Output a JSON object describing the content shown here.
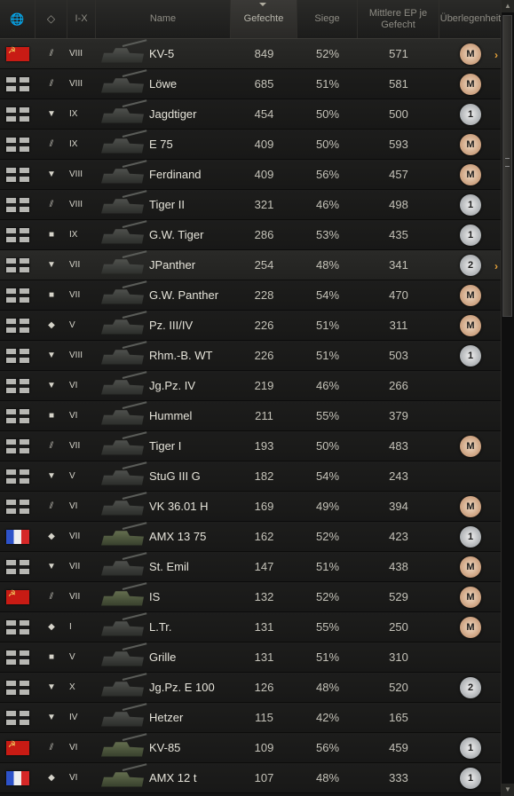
{
  "header": {
    "globe_icon": "globe-icon",
    "class_icon": "tank-class-icon",
    "tier_label": "I-X",
    "name_label": "Name",
    "battles_label": "Gefechte",
    "wins_label": "Siege",
    "avg_xp_label": "Mittlere EP je Gefecht",
    "mastery_label": "Überlegenheit"
  },
  "rows": [
    {
      "nation": "ussr",
      "cls": "⫽",
      "tier": "VIII",
      "name": "KV-5",
      "battles": "849",
      "wins": "52%",
      "xp": "571",
      "mastery": "M",
      "highlight": true,
      "arrow": "›"
    },
    {
      "nation": "germany",
      "cls": "⫽",
      "tier": "VIII",
      "name": "Löwe",
      "battles": "685",
      "wins": "51%",
      "xp": "581",
      "mastery": "M"
    },
    {
      "nation": "germany",
      "cls": "▼",
      "tier": "IX",
      "name": "Jagdtiger",
      "battles": "454",
      "wins": "50%",
      "xp": "500",
      "mastery": "1"
    },
    {
      "nation": "germany",
      "cls": "⫽",
      "tier": "IX",
      "name": "E 75",
      "battles": "409",
      "wins": "50%",
      "xp": "593",
      "mastery": "M"
    },
    {
      "nation": "germany",
      "cls": "▼",
      "tier": "VIII",
      "name": "Ferdinand",
      "battles": "409",
      "wins": "56%",
      "xp": "457",
      "mastery": "M"
    },
    {
      "nation": "germany",
      "cls": "⫽",
      "tier": "VIII",
      "name": "Tiger II",
      "battles": "321",
      "wins": "46%",
      "xp": "498",
      "mastery": "1"
    },
    {
      "nation": "germany",
      "cls": "■",
      "tier": "IX",
      "name": "G.W. Tiger",
      "battles": "286",
      "wins": "53%",
      "xp": "435",
      "mastery": "1"
    },
    {
      "nation": "germany",
      "cls": "▼",
      "tier": "VII",
      "name": "JPanther",
      "battles": "254",
      "wins": "48%",
      "xp": "341",
      "mastery": "2",
      "highlight": true,
      "arrow": "›"
    },
    {
      "nation": "germany",
      "cls": "■",
      "tier": "VII",
      "name": "G.W. Panther",
      "battles": "228",
      "wins": "54%",
      "xp": "470",
      "mastery": "M"
    },
    {
      "nation": "germany",
      "cls": "◆",
      "tier": "V",
      "name": "Pz. III/IV",
      "battles": "226",
      "wins": "51%",
      "xp": "311",
      "mastery": "M"
    },
    {
      "nation": "germany",
      "cls": "▼",
      "tier": "VIII",
      "name": "Rhm.-B. WT",
      "battles": "226",
      "wins": "51%",
      "xp": "503",
      "mastery": "1"
    },
    {
      "nation": "germany",
      "cls": "▼",
      "tier": "VI",
      "name": "Jg.Pz. IV",
      "battles": "219",
      "wins": "46%",
      "xp": "266",
      "mastery": ""
    },
    {
      "nation": "germany",
      "cls": "■",
      "tier": "VI",
      "name": "Hummel",
      "battles": "211",
      "wins": "55%",
      "xp": "379",
      "mastery": ""
    },
    {
      "nation": "germany",
      "cls": "⫽",
      "tier": "VII",
      "name": "Tiger I",
      "battles": "193",
      "wins": "50%",
      "xp": "483",
      "mastery": "M"
    },
    {
      "nation": "germany",
      "cls": "▼",
      "tier": "V",
      "name": "StuG III G",
      "battles": "182",
      "wins": "54%",
      "xp": "243",
      "mastery": ""
    },
    {
      "nation": "germany",
      "cls": "⫽",
      "tier": "VI",
      "name": "VK 36.01 H",
      "battles": "169",
      "wins": "49%",
      "xp": "394",
      "mastery": "M"
    },
    {
      "nation": "france",
      "cls": "◆",
      "tier": "VII",
      "name": "AMX 13 75",
      "battles": "162",
      "wins": "52%",
      "xp": "423",
      "mastery": "1",
      "green": true
    },
    {
      "nation": "germany",
      "cls": "▼",
      "tier": "VII",
      "name": "St. Emil",
      "battles": "147",
      "wins": "51%",
      "xp": "438",
      "mastery": "M"
    },
    {
      "nation": "ussr",
      "cls": "⫽",
      "tier": "VII",
      "name": "IS",
      "battles": "132",
      "wins": "52%",
      "xp": "529",
      "mastery": "M",
      "green": true
    },
    {
      "nation": "germany",
      "cls": "◆",
      "tier": "I",
      "name": "L.Tr.",
      "battles": "131",
      "wins": "55%",
      "xp": "250",
      "mastery": "M"
    },
    {
      "nation": "germany",
      "cls": "■",
      "tier": "V",
      "name": "Grille",
      "battles": "131",
      "wins": "51%",
      "xp": "310",
      "mastery": ""
    },
    {
      "nation": "germany",
      "cls": "▼",
      "tier": "X",
      "name": "Jg.Pz. E 100",
      "battles": "126",
      "wins": "48%",
      "xp": "520",
      "mastery": "2"
    },
    {
      "nation": "germany",
      "cls": "▼",
      "tier": "IV",
      "name": "Hetzer",
      "battles": "115",
      "wins": "42%",
      "xp": "165",
      "mastery": ""
    },
    {
      "nation": "ussr",
      "cls": "⫽",
      "tier": "VI",
      "name": "KV-85",
      "battles": "109",
      "wins": "56%",
      "xp": "459",
      "mastery": "1",
      "green": true
    },
    {
      "nation": "france",
      "cls": "◆",
      "tier": "VI",
      "name": "AMX 12 t",
      "battles": "107",
      "wins": "48%",
      "xp": "333",
      "mastery": "1",
      "green": true
    }
  ],
  "scrollbar": {
    "up": "▲",
    "down": "▼"
  }
}
